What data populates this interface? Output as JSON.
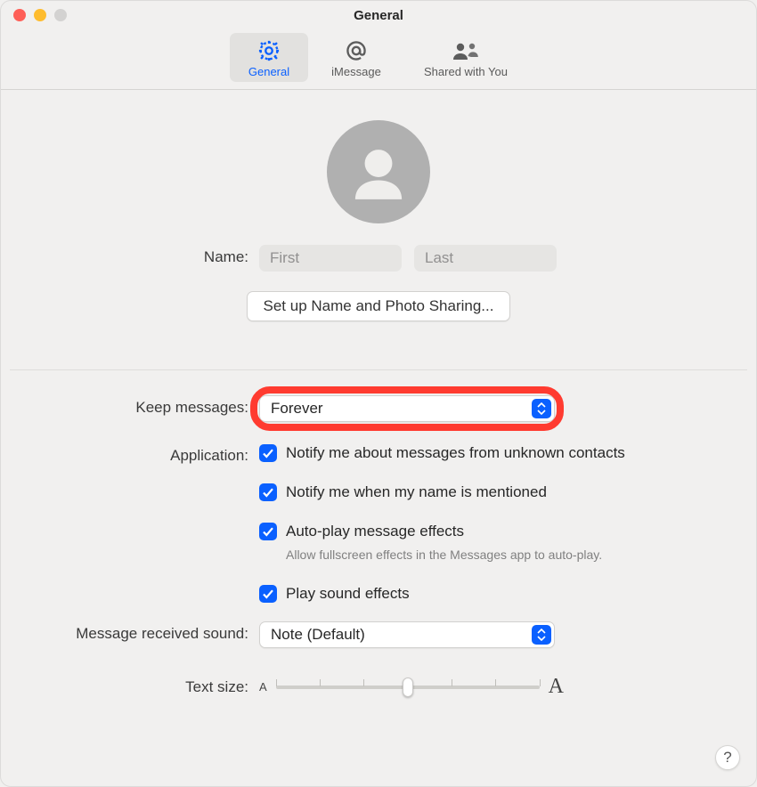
{
  "window": {
    "title": "General"
  },
  "tabs": {
    "general": "General",
    "imessage": "iMessage",
    "shared": "Shared with You"
  },
  "name": {
    "label": "Name:",
    "first_placeholder": "First",
    "last_placeholder": "Last"
  },
  "setup_button": "Set up Name and Photo Sharing...",
  "keep_messages": {
    "label": "Keep messages:",
    "value": "Forever"
  },
  "application": {
    "label": "Application:",
    "notify_unknown": "Notify me about messages from unknown contacts",
    "notify_mention": "Notify me when my name is mentioned",
    "autoplay": "Auto-play message effects",
    "autoplay_hint": "Allow fullscreen effects in the Messages app to auto-play.",
    "play_sound": "Play sound effects"
  },
  "sound": {
    "label": "Message received sound:",
    "value": "Note (Default)"
  },
  "text_size": {
    "label": "Text size:",
    "small_glyph": "A",
    "big_glyph": "A"
  },
  "help_glyph": "?"
}
